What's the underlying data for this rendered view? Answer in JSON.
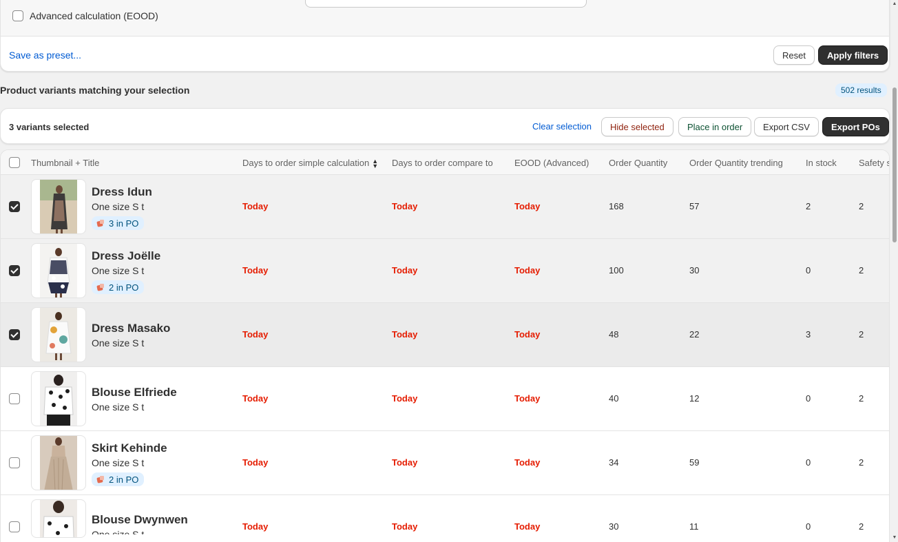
{
  "filters": {
    "advanced_label": "Advanced calculation (EOOD)",
    "advanced_checked": false,
    "save_preset_label": "Save as preset...",
    "reset_label": "Reset",
    "apply_label": "Apply filters"
  },
  "results": {
    "title": "Product variants matching your selection",
    "count_label": "502 results"
  },
  "selection": {
    "count_label": "3 variants selected",
    "clear_label": "Clear selection",
    "hide_label": "Hide selected",
    "place_label": "Place in order",
    "export_csv_label": "Export CSV",
    "export_pos_label": "Export POs"
  },
  "table": {
    "columns": {
      "title": "Thumbnail + Title",
      "days_simple": "Days to order simple calculation",
      "days_compare": "Days to order compare to",
      "eood": "EOOD (Advanced)",
      "order_qty": "Order Quantity",
      "order_qty_trending": "Order Quantity trending",
      "in_stock": "In stock",
      "safety": "Safety s"
    },
    "rows": [
      {
        "title": "Dress Idun",
        "variant": "One size S t",
        "po": "3 in PO",
        "days_simple": "Today",
        "days_compare": "Today",
        "eood": "Today",
        "order_qty": "168",
        "trending": "57",
        "in_stock": "2",
        "safety": "2",
        "selected": true
      },
      {
        "title": "Dress Joëlle",
        "variant": "One size S t",
        "po": "2 in PO",
        "days_simple": "Today",
        "days_compare": "Today",
        "eood": "Today",
        "order_qty": "100",
        "trending": "30",
        "in_stock": "0",
        "safety": "2",
        "selected": true
      },
      {
        "title": "Dress Masako",
        "variant": "One size S t",
        "po": "",
        "days_simple": "Today",
        "days_compare": "Today",
        "eood": "Today",
        "order_qty": "48",
        "trending": "22",
        "in_stock": "3",
        "safety": "2",
        "selected": true
      },
      {
        "title": "Blouse Elfriede",
        "variant": "One size S t",
        "po": "",
        "days_simple": "Today",
        "days_compare": "Today",
        "eood": "Today",
        "order_qty": "40",
        "trending": "12",
        "in_stock": "0",
        "safety": "2",
        "selected": false
      },
      {
        "title": "Skirt Kehinde",
        "variant": "One size S t",
        "po": "2 in PO",
        "days_simple": "Today",
        "days_compare": "Today",
        "eood": "Today",
        "order_qty": "34",
        "trending": "59",
        "in_stock": "0",
        "safety": "2",
        "selected": false
      },
      {
        "title": "Blouse Dwynwen",
        "variant": "One size S t",
        "po": "",
        "days_simple": "Today",
        "days_compare": "Today",
        "eood": "Today",
        "order_qty": "30",
        "trending": "11",
        "in_stock": "0",
        "safety": "2",
        "selected": false
      }
    ]
  },
  "colors": {
    "accent_link": "#005bd3",
    "urgent_red": "#e51c00",
    "primary_button": "#303030",
    "badge_bg": "#e0f0ff"
  }
}
